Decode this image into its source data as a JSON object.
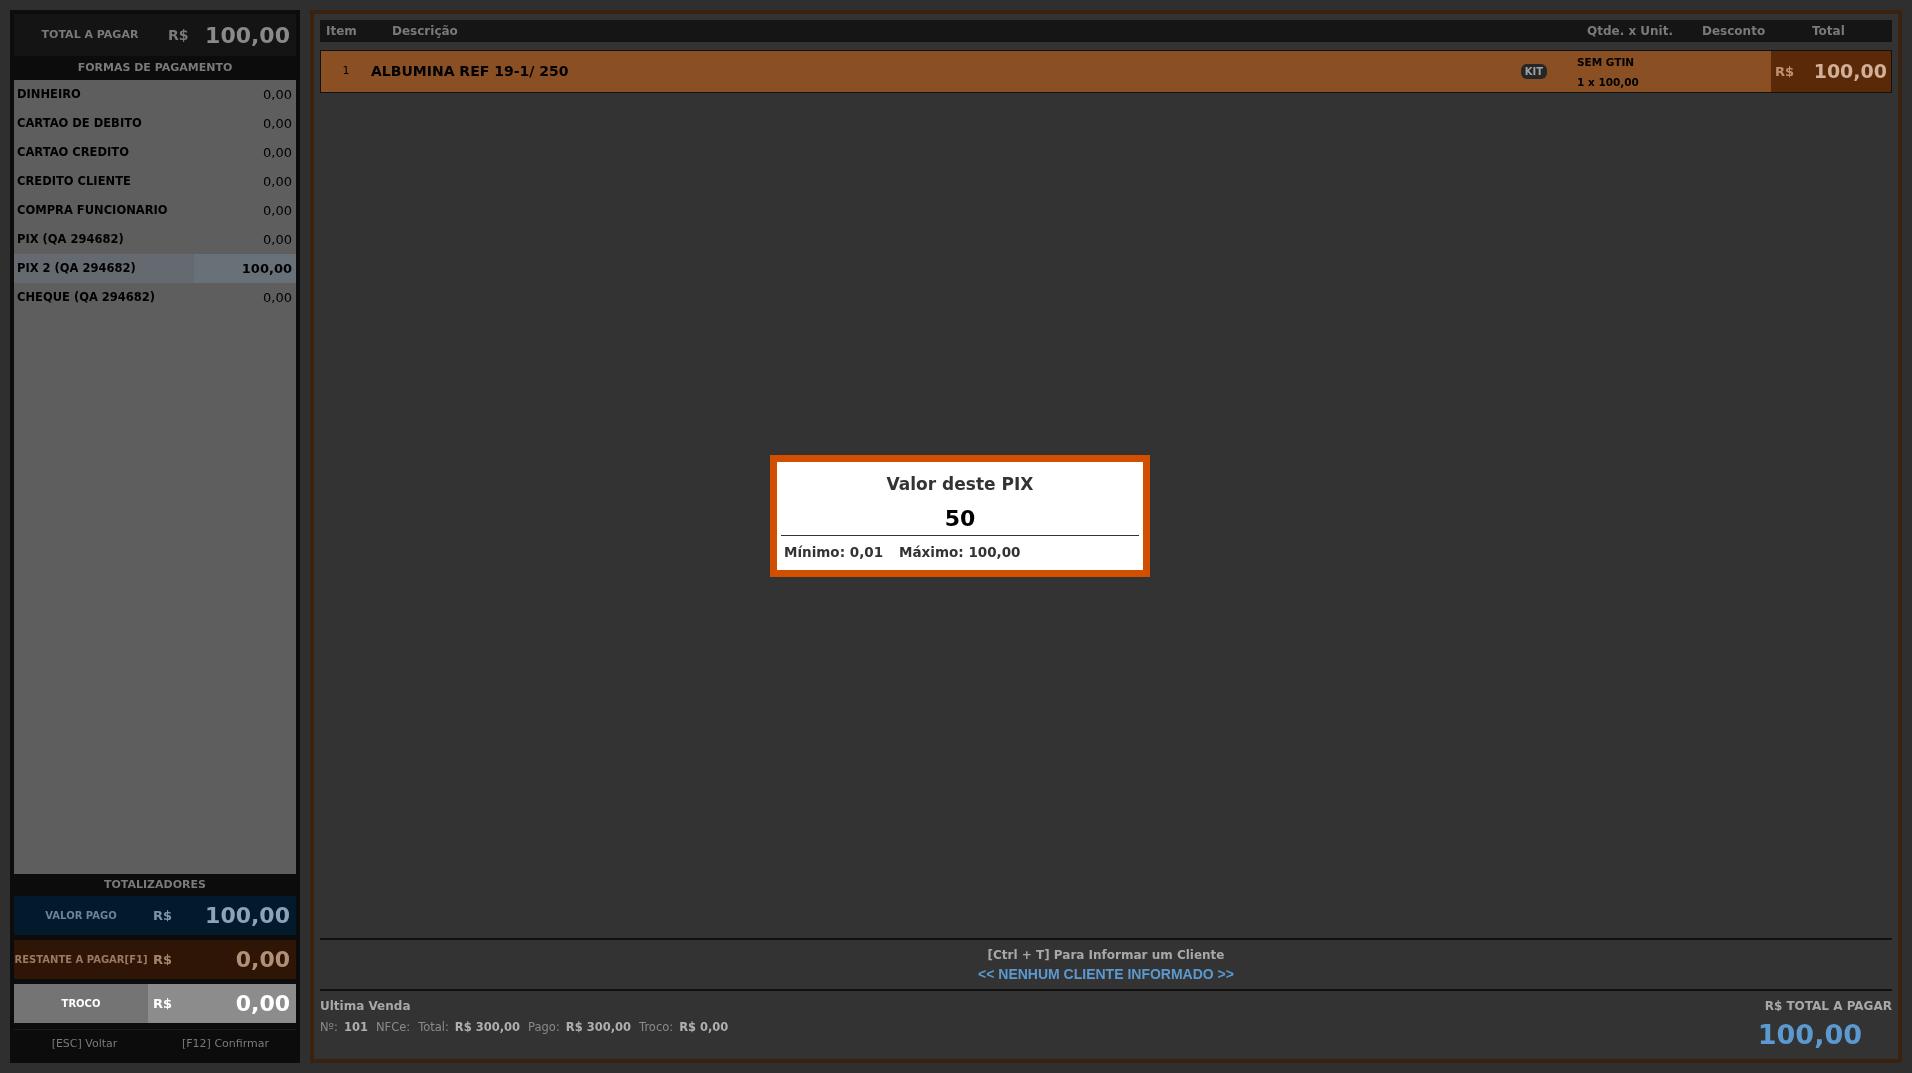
{
  "summary": {
    "label": "TOTAL A PAGAR",
    "currency": "R$",
    "value": "100,00"
  },
  "payment_methods": {
    "title": "FORMAS DE PAGAMENTO",
    "items": [
      {
        "name": "DINHEIRO",
        "value": "0,00",
        "selected": false
      },
      {
        "name": "CARTAO DE DEBITO",
        "value": "0,00",
        "selected": false
      },
      {
        "name": "CARTAO CREDITO",
        "value": "0,00",
        "selected": false
      },
      {
        "name": "CREDITO CLIENTE",
        "value": "0,00",
        "selected": false
      },
      {
        "name": "COMPRA FUNCIONARIO",
        "value": "0,00",
        "selected": false
      },
      {
        "name": "PIX (QA 294682)",
        "value": "0,00",
        "selected": false
      },
      {
        "name": "PIX 2 (QA 294682)",
        "value": "100,00",
        "selected": true
      },
      {
        "name": "CHEQUE (QA 294682)",
        "value": "0,00",
        "selected": false
      }
    ]
  },
  "totals": {
    "title": "TOTALIZADORES",
    "rows": [
      {
        "kind": "paid",
        "label": "VALOR PAGO",
        "currency": "R$",
        "value": "100,00"
      },
      {
        "kind": "remaining",
        "label": "RESTANTE A PAGAR[F1]",
        "currency": "R$",
        "value": "0,00"
      },
      {
        "kind": "change",
        "label": "TROCO",
        "currency": "R$",
        "value": "0,00"
      }
    ]
  },
  "shortcuts": [
    "[ESC] Voltar",
    "[F12] Confirmar"
  ],
  "table": {
    "columns": [
      "Item",
      "Descrição",
      "Qtde. x Unit.",
      "Desconto",
      "Total"
    ],
    "rows": [
      {
        "item": "1",
        "description": "ALBUMINA REF 19-1/ 250",
        "badge": "KIT",
        "gtin": "SEM GTIN",
        "quantity": "1 x 100,00",
        "currency": "R$",
        "total": "100,00"
      }
    ]
  },
  "customer": {
    "hint": "[Ctrl + T] Para Informar um Cliente",
    "name": "<< NENHUM CLIENTE INFORMADO >>"
  },
  "last_sale": {
    "title": "Ultima Venda",
    "fields": [
      {
        "label": "Nº:",
        "value": "101"
      },
      {
        "label": "NFCe:"
      },
      {
        "label": "Total:",
        "value": "R$ 300,00"
      },
      {
        "label": "Pago:",
        "value": "R$ 300,00"
      },
      {
        "label": "Troco:",
        "value": "R$ 0,00"
      }
    ]
  },
  "grand_total": {
    "label": "R$ TOTAL A PAGAR",
    "value": "100,00"
  },
  "dialog": {
    "title": "Valor deste PIX",
    "value": "50",
    "minimum": "Mínimo: 0,01",
    "maximum": "Máximo: 100,00"
  }
}
